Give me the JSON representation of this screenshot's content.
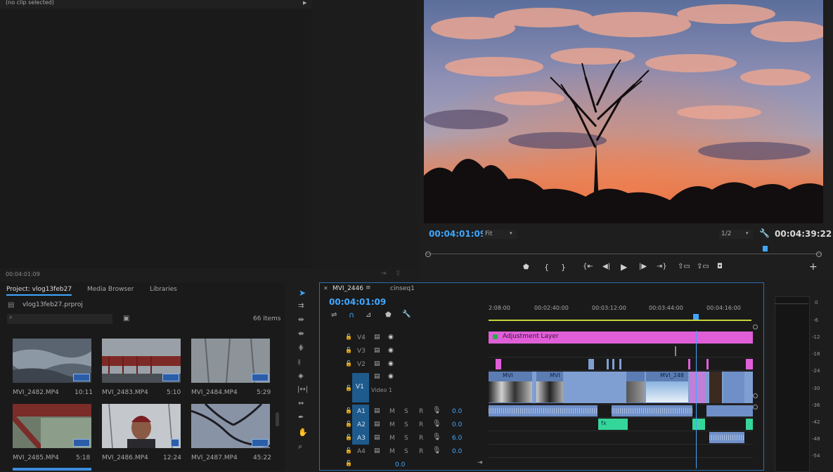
{
  "source_monitor": {
    "clip_label": "(no clip selected)",
    "timecode": "00:04:01:09"
  },
  "program_monitor": {
    "timecode": "00:04:01:09",
    "fit": "Fit",
    "resolution": "1/2",
    "duration": "00:04:39:22"
  },
  "project_panel": {
    "tabs": [
      "Project: vlog13feb27",
      "Media Browser",
      "Libraries"
    ],
    "file": "vlog13feb27.prproj",
    "item_count": "66 Items",
    "search_placeholder": "",
    "clips": [
      {
        "name": "MVI_2482.MP4",
        "duration": "10:11"
      },
      {
        "name": "MVI_2483.MP4",
        "duration": "5:10"
      },
      {
        "name": "MVI_2484.MP4",
        "duration": "5:29"
      },
      {
        "name": "MVI_2485.MP4",
        "duration": "5:18"
      },
      {
        "name": "MVI_2486.MP4",
        "duration": "12:24"
      },
      {
        "name": "MVI_2487.MP4",
        "duration": "45:22"
      }
    ]
  },
  "timeline": {
    "tabs": [
      "MVI_2446",
      "cinseq1"
    ],
    "timecode": "00:04:01:09",
    "ruler": [
      "2:08:00",
      "00:02:40:00",
      "00:03:12:00",
      "00:03:44:00",
      "00:04:16:00"
    ],
    "video_tracks": [
      "V4",
      "V3",
      "V2",
      "V1"
    ],
    "v1_name": "Video 1",
    "audio_tracks": [
      {
        "name": "A1",
        "level": "0.0"
      },
      {
        "name": "A2",
        "level": "0.0"
      },
      {
        "name": "A3",
        "level": "6.0"
      },
      {
        "name": "A4",
        "level": "0.0"
      }
    ],
    "master_level": "0.0",
    "adjustment_layer": "Adjustment Layer",
    "clip_labels": [
      "MVI",
      "MVI",
      "MVI_248"
    ],
    "m": "M",
    "s": "S",
    "r": "R",
    "colors": {
      "adjustment": "#e05fd8",
      "video_clip": "#7f9fd3",
      "audio_clip": "#6f8fc8",
      "audio_green": "#35d69a",
      "accent": "#3fa7ff"
    }
  },
  "audio_meter": {
    "ticks": [
      "0",
      "-6",
      "-12",
      "-18",
      "-24",
      "-30",
      "-36",
      "-42",
      "-48",
      "-54"
    ]
  }
}
